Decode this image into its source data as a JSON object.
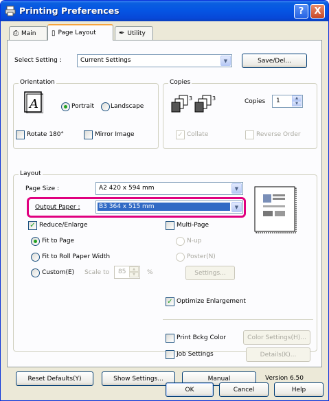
{
  "window": {
    "title": "Printing Preferences",
    "help_glyph": "?",
    "close_glyph": "X"
  },
  "tabs": [
    {
      "label": "Main",
      "icon": "printer-icon"
    },
    {
      "label": "Page Layout",
      "icon": "page-layout-icon"
    },
    {
      "label": "Utility",
      "icon": "wrench-icon"
    }
  ],
  "select_setting": {
    "label": "Select Setting :",
    "value": "Current Settings",
    "save_button": "Save/Del..."
  },
  "orientation": {
    "title": "Orientation",
    "portrait": "Portrait",
    "landscape": "Landscape",
    "selected": "Portrait",
    "rotate_180": "Rotate 180°",
    "mirror_image": "Mirror Image"
  },
  "copies": {
    "title": "Copies",
    "label": "Copies",
    "value": "1",
    "collate": "Collate",
    "reverse_order": "Reverse Order"
  },
  "layout": {
    "title": "Layout",
    "page_size_label": "Page Size :",
    "page_size_value": "A2 420 x 594 mm",
    "output_paper_label": "Output Paper :",
    "output_paper_value": "B3 364 x 515 mm",
    "reduce_enlarge": "Reduce/Enlarge",
    "fit_to_page": "Fit to Page",
    "fit_to_roll": "Fit to Roll Paper Width",
    "custom": "Custom(E)",
    "scale_to": "Scale to",
    "scale_value": "85",
    "percent": "%",
    "multi_page": "Multi-Page",
    "n_up": "N-up",
    "poster": "Poster(N)",
    "settings_button": "Settings...",
    "optimize_enlargement": "Optimize Enlargement",
    "print_bckg_color": "Print Bckg Color",
    "color_settings_button": "Color Settings(H)...",
    "job_settings": "Job Settings",
    "details_button": "Details(K)..."
  },
  "bottom": {
    "reset_defaults": "Reset Defaults(Y)",
    "show_settings": "Show Settings...",
    "manual": "Manual",
    "version": "Version 6.50"
  },
  "dialog_buttons": {
    "ok": "OK",
    "cancel": "Cancel",
    "help": "Help"
  },
  "colors": {
    "titlebar": "#0554e3",
    "highlight": "#e0007f",
    "selection": "#316ac5",
    "check_green": "#21a121"
  }
}
